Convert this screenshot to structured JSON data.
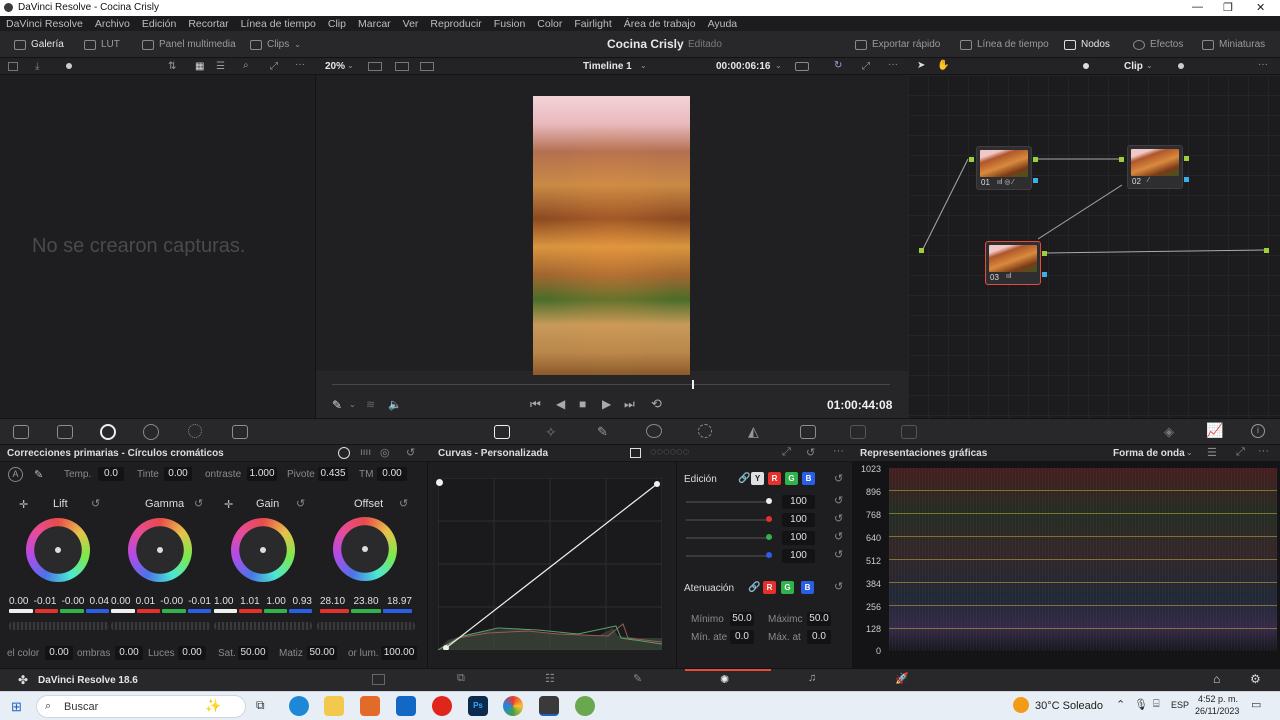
{
  "window": {
    "title": "DaVinci Resolve - Cocina Crisly"
  },
  "menu": [
    "DaVinci Resolve",
    "Archivo",
    "Edición",
    "Recortar",
    "Línea de tiempo",
    "Clip",
    "Marcar",
    "Ver",
    "Reproducir",
    "Fusion",
    "Color",
    "Fairlight",
    "Área de trabajo",
    "Ayuda"
  ],
  "toolbar": {
    "gallery": "Galería",
    "lut": "LUT",
    "media": "Panel multimedia",
    "clips": "Clips",
    "project": "Cocina Crisly",
    "status": "Editado",
    "export": "Exportar rápido",
    "timeline": "Línea de tiempo",
    "nodes": "Nodos",
    "effects": "Efectos",
    "thumbs": "Miniaturas"
  },
  "viewerbar": {
    "zoom": "20%",
    "timeline": "Timeline 1",
    "timecode": "00:00:06:16",
    "clip": "Clip"
  },
  "gallery": {
    "empty": "No se crearon capturas."
  },
  "viewer": {
    "timecode": "01:00:44:08"
  },
  "nodes": [
    {
      "label": "01"
    },
    {
      "label": "02"
    },
    {
      "label": "03"
    }
  ],
  "primaries": {
    "title": "Correcciones primarias - Círculos cromáticos",
    "params": [
      {
        "label": "Temp.",
        "value": "0.0"
      },
      {
        "label": "Tinte",
        "value": "0.00"
      },
      {
        "label": "ontraste",
        "value": "1.000"
      },
      {
        "label": "Pivote",
        "value": "0.435"
      },
      {
        "label": "TM",
        "value": "0.00"
      }
    ],
    "wheels": [
      {
        "name": "Lift",
        "values": [
          "0.00",
          "-0.01",
          "-0.00",
          "0.04"
        ]
      },
      {
        "name": "Gamma",
        "values": [
          "0.00",
          "0.01",
          "-0.00",
          "-0.01"
        ]
      },
      {
        "name": "Gain",
        "values": [
          "1.00",
          "1.01",
          "1.00",
          "0.93"
        ]
      },
      {
        "name": "Offset",
        "values": [
          "28.10",
          "23.80",
          "18.97"
        ]
      }
    ],
    "bottom": [
      {
        "label": "el color",
        "value": "0.00"
      },
      {
        "label": "ombras",
        "value": "0.00"
      },
      {
        "label": "Luces",
        "value": "0.00"
      },
      {
        "label": "Sat.",
        "value": "50.00"
      },
      {
        "label": "Matiz",
        "value": "50.00"
      },
      {
        "label": "or lum.",
        "value": "100.00"
      }
    ]
  },
  "curves": {
    "title": "Curvas - Personalizada",
    "edit_label": "Edición",
    "channels": [
      "Y",
      "R",
      "G",
      "B"
    ],
    "intensities": [
      "100",
      "100",
      "100",
      "100"
    ],
    "atten_label": "Atenuación",
    "min_label": "Mínimo",
    "min_value": "50.0",
    "max_label": "Máximc",
    "max_value": "50.0",
    "minatt_label": "Mín. ate",
    "minatt_value": "0.0",
    "maxatt_label": "Máx. at",
    "maxatt_value": "0.0"
  },
  "scopes": {
    "title": "Representaciones gráficas",
    "mode": "Forma de onda",
    "ticks": [
      "1023",
      "896",
      "768",
      "640",
      "512",
      "384",
      "256",
      "128",
      "0"
    ]
  },
  "status": {
    "app": "DaVinci Resolve 18.6"
  },
  "taskbar": {
    "search": "Buscar",
    "weather": "30°C  Soleado",
    "lang": "ESP",
    "time": "4:52 p. m.",
    "date": "26/11/2023"
  },
  "colors": {
    "accent": "#e64b3c",
    "red": "#e5312b",
    "green": "#2fb34a",
    "blue": "#2a5ee6"
  }
}
